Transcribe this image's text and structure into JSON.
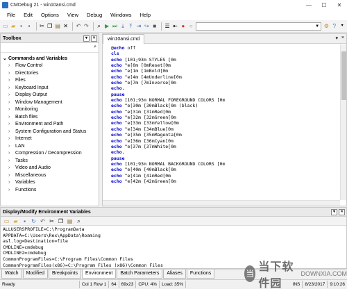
{
  "window": {
    "title": "CMDebug 21 - win10ansi.cmd",
    "controls": [
      "—",
      "☐",
      "✕"
    ]
  },
  "menu": [
    "File",
    "Edit",
    "Options",
    "View",
    "Debug",
    "Windows",
    "Help"
  ],
  "toolbox": {
    "title": "Toolbox",
    "category": "Commands and Variables",
    "items": [
      "Flow Control",
      "Directories",
      "Files",
      "Keyboard Input",
      "Display Output",
      "Window Management",
      "Monitoring",
      "Batch files",
      "Environment and Path",
      "System Configuration and Status",
      "Internet",
      "LAN",
      "Compression / Decompression",
      "Tasks",
      "Video and Audio",
      "Miscellaneous",
      "Variables",
      "Functions"
    ]
  },
  "editor": {
    "tab": "win10ansi.cmd",
    "lines": [
      [
        {
          "c": "tx",
          "t": "@"
        },
        {
          "c": "kw",
          "t": "echo"
        },
        {
          "c": "tx",
          "t": " off"
        }
      ],
      [
        {
          "c": "kw",
          "t": "cls"
        }
      ],
      [
        {
          "c": "kw",
          "t": "echo"
        },
        {
          "c": "tx",
          "t": " [101;93m STYLES [0m"
        }
      ],
      [
        {
          "c": "kw",
          "t": "echo"
        },
        {
          "c": "tx",
          "t": " ^e[0m [0mReset[0m"
        }
      ],
      [
        {
          "c": "kw",
          "t": "echo"
        },
        {
          "c": "tx",
          "t": " ^e[1m [1mBold[0m"
        }
      ],
      [
        {
          "c": "kw",
          "t": "echo"
        },
        {
          "c": "tx",
          "t": " ^e[4m [4mUnderline[0m"
        }
      ],
      [
        {
          "c": "kw",
          "t": "echo"
        },
        {
          "c": "tx",
          "t": " ^e[7m [7mInverse[0m"
        }
      ],
      [
        {
          "c": "kw",
          "t": "echo."
        }
      ],
      [
        {
          "c": "kw",
          "t": "pause"
        }
      ],
      [
        {
          "c": "kw",
          "t": "echo"
        },
        {
          "c": "tx",
          "t": " [101;93m NORMAL FOREGROUND COLORS [0m"
        }
      ],
      [
        {
          "c": "kw",
          "t": "echo"
        },
        {
          "c": "tx",
          "t": " ^e[30m [30mBlack[0m (black)"
        }
      ],
      [
        {
          "c": "kw",
          "t": "echo"
        },
        {
          "c": "tx",
          "t": " ^e[31m [31mRed[0m"
        }
      ],
      [
        {
          "c": "kw",
          "t": "echo"
        },
        {
          "c": "tx",
          "t": " ^e[32m [32mGreen[0m"
        }
      ],
      [
        {
          "c": "kw",
          "t": "echo"
        },
        {
          "c": "tx",
          "t": " ^e[33m [33mYellow[0m"
        }
      ],
      [
        {
          "c": "kw",
          "t": "echo"
        },
        {
          "c": "tx",
          "t": " ^e[34m [34mBlue[0m"
        }
      ],
      [
        {
          "c": "kw",
          "t": "echo"
        },
        {
          "c": "tx",
          "t": " ^e[35m [35mMagenta[0m"
        }
      ],
      [
        {
          "c": "kw",
          "t": "echo"
        },
        {
          "c": "tx",
          "t": " ^e[36m [36mCyan[0m"
        }
      ],
      [
        {
          "c": "kw",
          "t": "echo"
        },
        {
          "c": "tx",
          "t": " ^e[37m [37mWhite[0m"
        }
      ],
      [
        {
          "c": "kw",
          "t": "echo."
        }
      ],
      [
        {
          "c": "kw",
          "t": "pause"
        }
      ],
      [
        {
          "c": "kw",
          "t": "echo"
        },
        {
          "c": "tx",
          "t": " [101;93m NORMAL BACKGROUND COLORS [0m"
        }
      ],
      [
        {
          "c": "kw",
          "t": "echo"
        },
        {
          "c": "tx",
          "t": " ^e[40m [40mBlack[0m"
        }
      ],
      [
        {
          "c": "kw",
          "t": "echo"
        },
        {
          "c": "tx",
          "t": " ^e[41m [41mRed[0m"
        }
      ],
      [
        {
          "c": "kw",
          "t": "echo"
        },
        {
          "c": "tx",
          "t": " ^e[42m [42mGreen[0m"
        }
      ]
    ]
  },
  "env": {
    "title": "Display/Modify Environment Variables",
    "lines": [
      "ALLUSERSPROFILE=C:\\ProgramData",
      "APPDATA=C:\\Users\\Rex\\AppData\\Roaming",
      "asl.log=Destination=file",
      "CMDLINE=cmdebug",
      "CMDLINE2=cmdebug",
      "CommonProgramFiles=C:\\Program Files\\Common Files",
      "CommonProgramFiles(x86)=C:\\Program Files (x86)\\Common Files"
    ]
  },
  "bottom_tabs": [
    "Watch",
    "Modified",
    "Breakpoints",
    "Environment",
    "Batch Parameters",
    "Aliases",
    "Functions"
  ],
  "bottom_tabs_active": "Environment",
  "status": {
    "ready": "Ready",
    "col_row": "Col 1 Row 1",
    "num": "64",
    "size": "69x23",
    "cpu": "CPU:  4%",
    "load": "Load: 35%",
    "ins": "INS",
    "date": "8/23/2017",
    "time": "9:10:26"
  },
  "watermark": {
    "mark": "当",
    "text": "当下软件园",
    "sub": "DOWNXIA.COM"
  },
  "colors": {
    "keyword": "#0000cc",
    "accent_run": "#2e9e3e",
    "accent_stop": "#d23a2a"
  }
}
